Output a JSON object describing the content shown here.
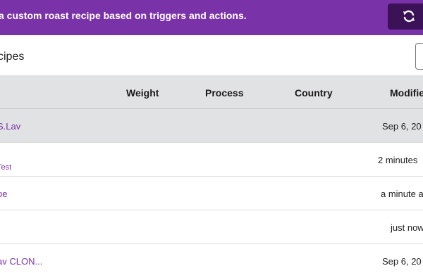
{
  "banner": {
    "text": "a custom roast recipe based on triggers and actions.",
    "sync_icon": "sync-icon",
    "color": "#7a32a9",
    "button_color": "#3b1257"
  },
  "section": {
    "title": "cipes"
  },
  "table": {
    "headers": {
      "weight": "Weight",
      "process": "Process",
      "country": "Country",
      "modified": "Modifie"
    },
    "rows": [
      {
        "name": "S.Lav",
        "sub": "",
        "modified": "Sep 6, 20",
        "selected": true
      },
      {
        "name": "",
        "sub": "Test",
        "modified": "2 minutes",
        "selected": false
      },
      {
        "name": "pe",
        "sub": "",
        "modified": "a minute a",
        "selected": false
      },
      {
        "name": "",
        "sub": "",
        "modified": "just now",
        "selected": false
      },
      {
        "name": "av CLON...",
        "sub": "",
        "modified": "Sep 6, 20",
        "selected": false
      }
    ]
  }
}
